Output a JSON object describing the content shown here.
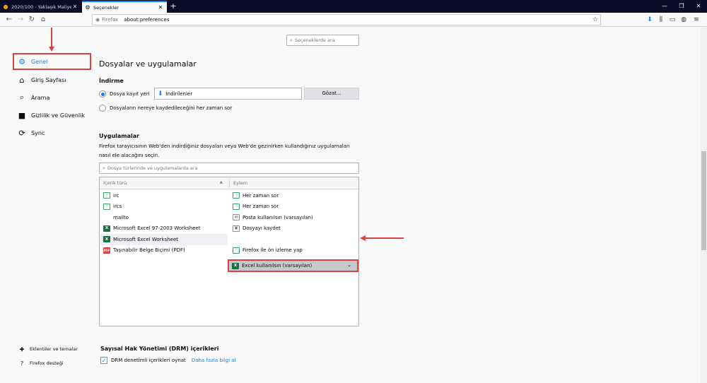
{
  "tabs": [
    {
      "label": "2020/100 - Yaklaşık Maliyet - E",
      "active": false
    },
    {
      "label": "Seçenekler",
      "active": true
    }
  ],
  "urlbar": {
    "identity": "Firefox",
    "url": "about:preferences"
  },
  "search": {
    "placeholder": "Seçeneklerde ara"
  },
  "sidebar": {
    "items": [
      {
        "label": "Genel",
        "icon": "gear-icon"
      },
      {
        "label": "Giriş Sayfası",
        "icon": "home-icon"
      },
      {
        "label": "Arama",
        "icon": "search-icon"
      },
      {
        "label": "Gizlilik ve Güvenlik",
        "icon": "lock-icon"
      },
      {
        "label": "Sync",
        "icon": "sync-icon"
      }
    ],
    "footer": [
      {
        "label": "Eklentiler ve temalar",
        "icon": "puzzle-icon"
      },
      {
        "label": "Firefox desteği",
        "icon": "help-icon"
      }
    ]
  },
  "main": {
    "heading": "Dosyalar ve uygulamalar",
    "download": {
      "title": "İndirme",
      "save_to_label": "Dosya kayıt yeri",
      "folder": "İndirilenler",
      "browse_label": "Gözat...",
      "always_ask_label": "Dosyaların nereye kaydedileceğini her zaman sor"
    },
    "apps": {
      "title": "Uygulamalar",
      "description": "Firefox tarayıcısının Web'den indirdiğiniz dosyaları veya Web'de gezinirken kullandığınız uygulamaları nasıl ele alacağını seçin.",
      "search_placeholder": "Dosya türlerinde ve uygulamalarda ara",
      "col_type": "İçerik türü",
      "col_action": "Eylem",
      "rows": [
        {
          "type": "irc",
          "type_icon": "ask",
          "action": "Her zaman sor",
          "action_icon": "ask"
        },
        {
          "type": "ircs",
          "type_icon": "ask",
          "action": "Her zaman sor",
          "action_icon": "ask"
        },
        {
          "type": "mailto",
          "type_icon": "none",
          "action": "Posta kullanılsın (varsayılan)",
          "action_icon": "mail"
        },
        {
          "type": "Microsoft Excel 97-2003 Worksheet",
          "type_icon": "xls",
          "action": "Dosyayı kaydet",
          "action_icon": "save"
        },
        {
          "type": "Microsoft Excel Worksheet",
          "type_icon": "xls",
          "action": "Excel kullanılsın (varsayılan)",
          "action_icon": "xls"
        },
        {
          "type": "Taşınabilir Belge Biçimi (PDF)",
          "type_icon": "pdf",
          "action": "Firefox ile ön izleme yap",
          "action_icon": "ask"
        }
      ]
    },
    "drm": {
      "title": "Sayısal Hak Yönetimi (DRM) içerikleri",
      "checkbox_label": "DRM denetimli içerikleri oynat",
      "link": "Daha fazla bilgi al"
    }
  },
  "icons": {
    "ask": "!",
    "xls": "X",
    "pdf": "PDF",
    "mail": "✉",
    "save": "▣",
    "none": ""
  },
  "colors": {
    "accent": "#0a84ff",
    "highlight": "#e04040",
    "tabbar": "#0c0c2a"
  }
}
